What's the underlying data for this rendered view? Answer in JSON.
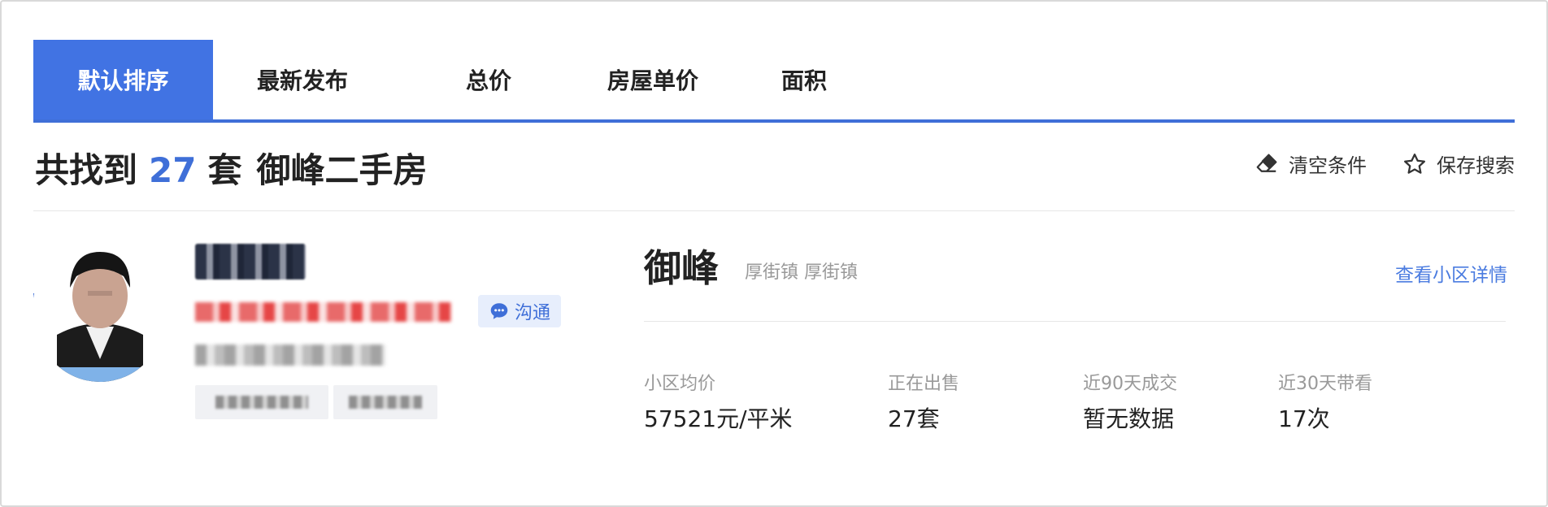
{
  "sort_tabs": [
    {
      "label": "默认排序",
      "active": true
    },
    {
      "label": "最新发布",
      "active": false
    },
    {
      "label": "总价",
      "active": false
    },
    {
      "label": "房屋单价",
      "active": false
    },
    {
      "label": "面积",
      "active": false
    }
  ],
  "result": {
    "prefix": "共找到",
    "count": "27",
    "unit": "套",
    "query": "御峰二手房"
  },
  "actions": {
    "clear": "清空条件",
    "save": "保存搜索"
  },
  "agent": {
    "chat_label": "沟通"
  },
  "community": {
    "name": "御峰",
    "area": "厚街镇 厚街镇",
    "detail_link": "查看小区详情",
    "stats": [
      {
        "label": "小区均价",
        "value": "57521元/平米"
      },
      {
        "label": "正在出售",
        "value": "27套"
      },
      {
        "label": "近90天成交",
        "value": "暂无数据"
      },
      {
        "label": "近30天带看",
        "value": "17次"
      }
    ]
  },
  "colors": {
    "accent": "#4173e3",
    "link": "#4b7ce0",
    "muted": "#999999"
  }
}
